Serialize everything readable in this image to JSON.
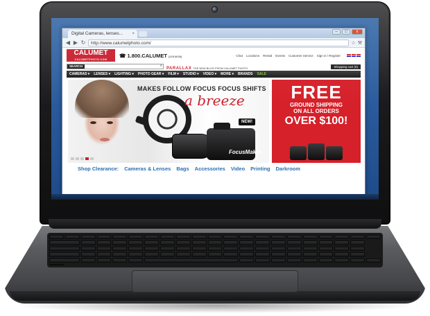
{
  "browser": {
    "tab_title": "Digital Cameras, lenses...",
    "tab_close": "×",
    "url": "http://www.calumetphoto.com/",
    "window_buttons": [
      "–",
      "□",
      "x"
    ]
  },
  "site": {
    "logo": "CALUMET",
    "logo_sub": "CALUMETPHOTO.COM",
    "phone": "1.800.CALUMET",
    "phone_sub": "(225.8638)",
    "top_links": [
      "Chat",
      "Locations",
      "Rental",
      "Events",
      "Customer Service",
      "Sign in / Register"
    ],
    "search_label": "SEARCH",
    "parallax": "PARALLAX",
    "parallax_sub": "THE NEW BLOG FROM CALUMET PHOTO",
    "cart": "Shopping cart (0)",
    "nav": [
      "CAMERAS ▾",
      "LENSES ▾",
      "LIGHTING ▾",
      "PHOTO GEAR ▾",
      "FILM ▾",
      "STUDIO ▾",
      "VIDEO ▾",
      "MORE ▾",
      "BRANDS",
      "SALE"
    ]
  },
  "banner": {
    "headline": "MAKES FOLLOW FOCUS FOCUS SHIFTS",
    "script": "a breeze",
    "badge": "NEW!",
    "brand": "FocusMaker"
  },
  "promo": {
    "line1": "FREE",
    "line2": "GROUND SHIPPING",
    "line3": "ON ALL ORDERS",
    "line4": "OVER $100!"
  },
  "clearance": {
    "lead": "Shop Clearance:",
    "links": [
      "Cameras & Lenses",
      "Bags",
      "Accessories",
      "Video",
      "Printing",
      "Darkroom"
    ]
  },
  "colors": {
    "brand_red": "#c8202f",
    "link_blue": "#2a6fb4",
    "sale_green": "#8cc34a"
  }
}
